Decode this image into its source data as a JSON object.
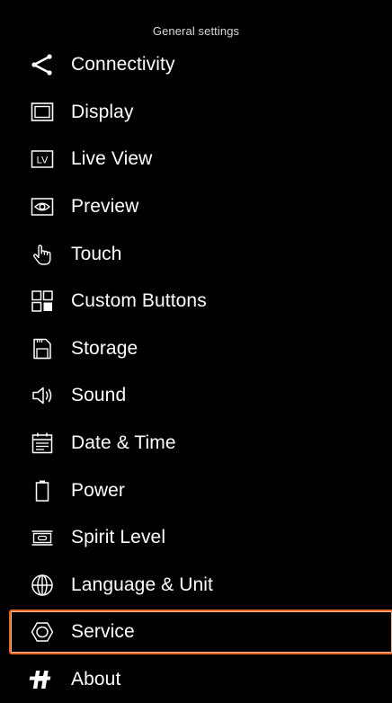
{
  "header": {
    "title": "General settings"
  },
  "colors": {
    "background": "#000000",
    "text": "#ffffff",
    "selection_border": "#e8672a"
  },
  "menu": {
    "selected_index": 12,
    "items": [
      {
        "label": "Connectivity",
        "icon": "share-icon"
      },
      {
        "label": "Display",
        "icon": "display-icon"
      },
      {
        "label": "Live View",
        "icon": "live-view-icon"
      },
      {
        "label": "Preview",
        "icon": "eye-icon"
      },
      {
        "label": "Touch",
        "icon": "touch-hand-icon"
      },
      {
        "label": "Custom Buttons",
        "icon": "custom-buttons-icon"
      },
      {
        "label": "Storage",
        "icon": "sd-card-icon"
      },
      {
        "label": "Sound",
        "icon": "speaker-icon"
      },
      {
        "label": "Date & Time",
        "icon": "calendar-icon"
      },
      {
        "label": "Power",
        "icon": "battery-icon"
      },
      {
        "label": "Spirit Level",
        "icon": "spirit-level-icon"
      },
      {
        "label": "Language & Unit",
        "icon": "globe-icon"
      },
      {
        "label": "Service",
        "icon": "service-nut-icon"
      },
      {
        "label": "About",
        "icon": "brand-h-icon"
      }
    ]
  }
}
